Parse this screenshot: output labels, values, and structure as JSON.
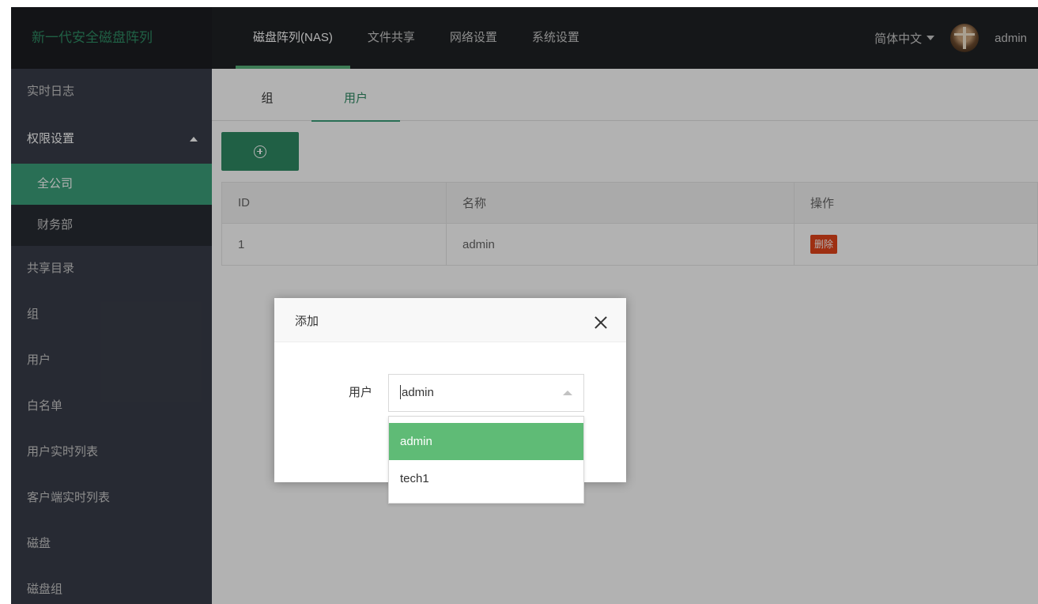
{
  "header": {
    "brand": "新一代安全磁盘阵列",
    "nav": [
      {
        "label": "磁盘阵列(NAS)",
        "active": true
      },
      {
        "label": "文件共享",
        "active": false
      },
      {
        "label": "网络设置",
        "active": false
      },
      {
        "label": "系统设置",
        "active": false
      }
    ],
    "language": "简体中文",
    "username": "admin"
  },
  "sidebar": {
    "items": [
      {
        "label": "实时日志"
      },
      {
        "label": "权限设置",
        "expanded": true
      },
      {
        "label": "全公司",
        "sub": true,
        "active": true
      },
      {
        "label": "财务部",
        "sub": true
      },
      {
        "label": "共享目录"
      },
      {
        "label": "组"
      },
      {
        "label": "用户"
      },
      {
        "label": "白名单"
      },
      {
        "label": "用户实时列表"
      },
      {
        "label": "客户端实时列表"
      },
      {
        "label": "磁盘"
      },
      {
        "label": "磁盘组"
      }
    ]
  },
  "tabs": [
    {
      "label": "组",
      "active": false
    },
    {
      "label": "用户",
      "active": true
    }
  ],
  "table": {
    "columns": [
      "ID",
      "名称",
      "操作"
    ],
    "rows": [
      {
        "id": "1",
        "name": "admin",
        "action": "删除"
      }
    ]
  },
  "modal": {
    "title": "添加",
    "field_label": "用户",
    "field_value": "admin",
    "options": [
      "admin",
      "tech1"
    ],
    "selected_option": "admin"
  },
  "colors": {
    "header_bg": "#1f2125",
    "sidebar_bg": "#393d49",
    "accent": "#2e8a63",
    "delete": "#e3441b",
    "option_selected": "#5fbb76"
  }
}
